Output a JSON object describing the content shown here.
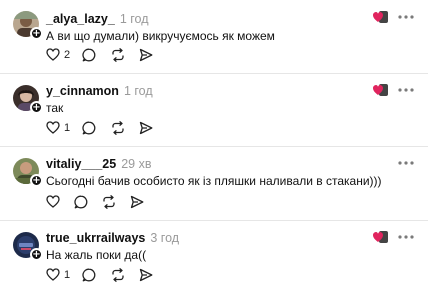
{
  "comments": [
    {
      "username": "_alya_lazy_",
      "time": "1 год",
      "text": "А ви що думали) викручуємось як можем",
      "likes": "2",
      "avatar_icon": "avatar-image",
      "follow_icon": "plus-icon"
    },
    {
      "username": "y_cinnamon",
      "time": "1 год",
      "text": "так",
      "likes": "1",
      "avatar_icon": "avatar-image",
      "follow_icon": "plus-icon"
    },
    {
      "username": "vitaliy___25",
      "time": "29 хв",
      "text": "Сьогодні бачив особисто як із пляшки наливали в стакани)))",
      "likes": "",
      "avatar_icon": "avatar-image",
      "follow_icon": "plus-icon"
    },
    {
      "username": "true_ukrrailways",
      "time": "3 год",
      "text": "На жаль поки да((",
      "likes": "1",
      "avatar_icon": "avatar-image",
      "follow_icon": "plus-icon"
    }
  ],
  "colors": {
    "text": "#101010",
    "muted": "#9a9a9a",
    "divider": "#e6e6e6",
    "reaction_red": "#e0245e"
  }
}
